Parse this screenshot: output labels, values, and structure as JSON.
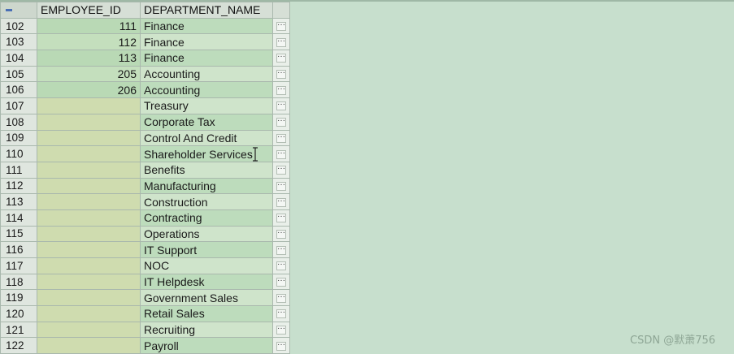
{
  "columns": {
    "employee_id": "EMPLOYEE_ID",
    "department_name": "DEPARTMENT_NAME"
  },
  "cell_button_glyph": "···",
  "rows": [
    {
      "row": "102",
      "employee_id": "111",
      "department_name": "Finance"
    },
    {
      "row": "103",
      "employee_id": "112",
      "department_name": "Finance"
    },
    {
      "row": "104",
      "employee_id": "113",
      "department_name": "Finance"
    },
    {
      "row": "105",
      "employee_id": "205",
      "department_name": "Accounting"
    },
    {
      "row": "106",
      "employee_id": "206",
      "department_name": "Accounting"
    },
    {
      "row": "107",
      "employee_id": "",
      "department_name": "Treasury"
    },
    {
      "row": "108",
      "employee_id": "",
      "department_name": "Corporate Tax"
    },
    {
      "row": "109",
      "employee_id": "",
      "department_name": "Control And Credit"
    },
    {
      "row": "110",
      "employee_id": "",
      "department_name": "Shareholder Services"
    },
    {
      "row": "111",
      "employee_id": "",
      "department_name": "Benefits"
    },
    {
      "row": "112",
      "employee_id": "",
      "department_name": "Manufacturing"
    },
    {
      "row": "113",
      "employee_id": "",
      "department_name": "Construction"
    },
    {
      "row": "114",
      "employee_id": "",
      "department_name": "Contracting"
    },
    {
      "row": "115",
      "employee_id": "",
      "department_name": "Operations"
    },
    {
      "row": "116",
      "employee_id": "",
      "department_name": "IT Support"
    },
    {
      "row": "117",
      "employee_id": "",
      "department_name": "NOC"
    },
    {
      "row": "118",
      "employee_id": "",
      "department_name": "IT Helpdesk"
    },
    {
      "row": "119",
      "employee_id": "",
      "department_name": "Government Sales"
    },
    {
      "row": "120",
      "employee_id": "",
      "department_name": "Retail Sales"
    },
    {
      "row": "121",
      "employee_id": "",
      "department_name": "Recruiting"
    },
    {
      "row": "122",
      "employee_id": "",
      "department_name": "Payroll"
    }
  ],
  "watermark": "CSDN @默萧756",
  "colors": {
    "background": "#c7dfcd",
    "row_even": "#cfe4cb",
    "row_odd": "#bddcbc"
  }
}
